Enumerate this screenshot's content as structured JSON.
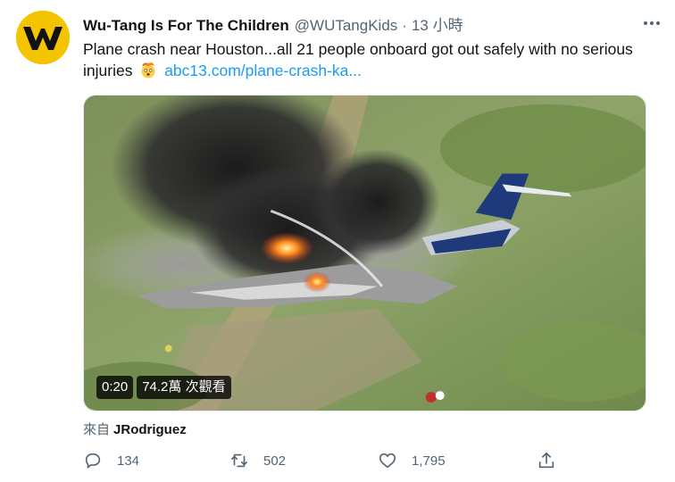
{
  "tweet": {
    "display_name": "Wu-Tang Is For The Children",
    "handle": "@WUTangKids",
    "separator": "·",
    "time": "13 小時",
    "text_main": "Plane crash near Houston...all 21 people onboard got out safely with no serious injuries",
    "emoji_icon": "exploding-head-emoji",
    "link_text": "abc13.com/plane-crash-ka...",
    "more_icon": "more-horizontal-icon"
  },
  "media": {
    "type": "video",
    "duration": "0:20",
    "views": "74.2萬 次觀看"
  },
  "source": {
    "prefix": "來自",
    "name": "JRodriguez"
  },
  "actions": {
    "reply": {
      "icon": "reply-icon",
      "count": "134"
    },
    "retweet": {
      "icon": "retweet-icon",
      "count": "502"
    },
    "like": {
      "icon": "heart-icon",
      "count": "1,795"
    },
    "share": {
      "icon": "share-icon"
    }
  },
  "colors": {
    "link": "#1d9bf0",
    "secondary_text": "#536471",
    "avatar_bg": "#f5c400"
  }
}
